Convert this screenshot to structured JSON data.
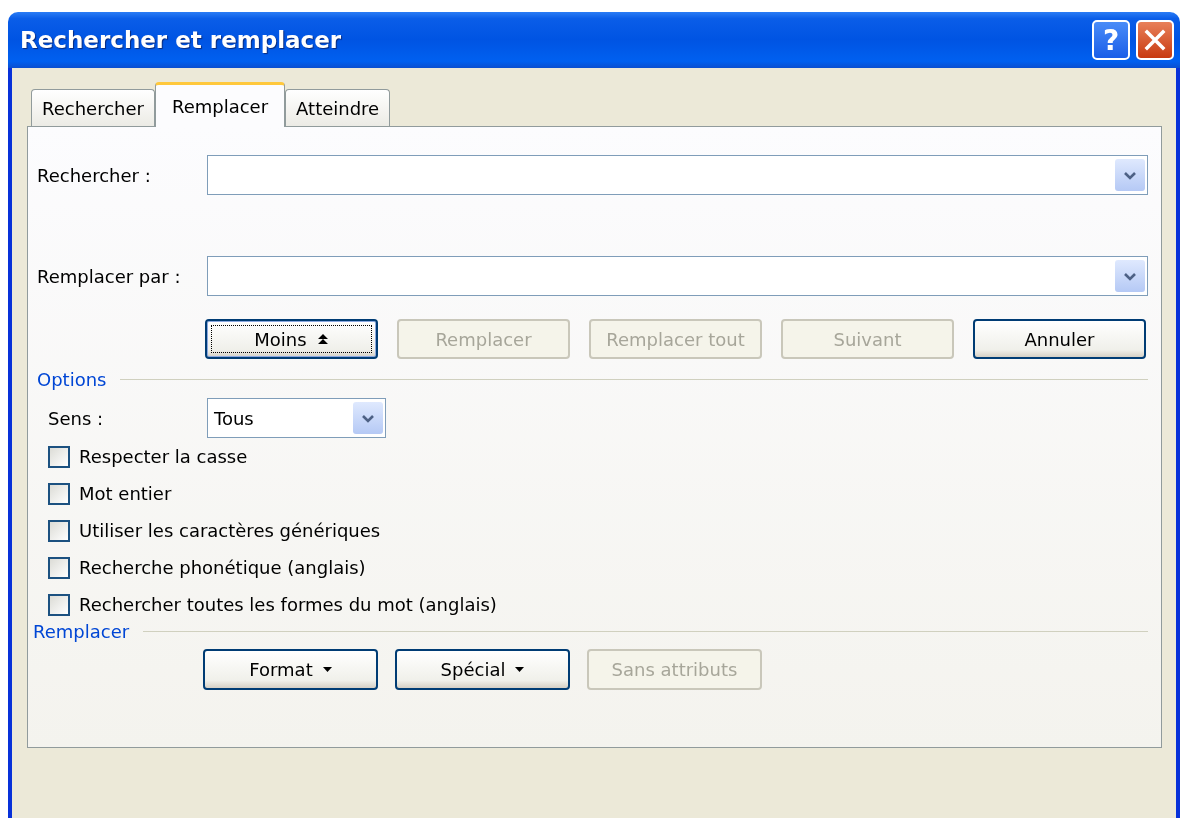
{
  "window": {
    "title": "Rechercher et remplacer",
    "help_button": "?"
  },
  "tabs": [
    {
      "label": "Rechercher",
      "selected": false
    },
    {
      "label": "Remplacer",
      "selected": true
    },
    {
      "label": "Atteindre",
      "selected": false
    }
  ],
  "fields": [
    {
      "label": "Rechercher :"
    },
    {
      "label": "Remplacer par :"
    }
  ],
  "actions": [
    {
      "label": "Moins",
      "kind": "toggle",
      "disabled": false,
      "focused": true
    },
    {
      "label": "Remplacer",
      "kind": "plain",
      "disabled": true,
      "focused": false
    },
    {
      "label": "Remplacer tout",
      "kind": "plain",
      "disabled": true,
      "focused": false
    },
    {
      "label": "Suivant",
      "kind": "plain",
      "disabled": true,
      "focused": false
    },
    {
      "label": "Annuler",
      "kind": "plain",
      "disabled": false,
      "focused": false
    }
  ],
  "options": {
    "title": "Options",
    "direction": {
      "label": "Sens :",
      "value": "Tous"
    },
    "checkboxes": [
      {
        "label": "Respecter la casse",
        "checked": false
      },
      {
        "label": "Mot entier",
        "checked": false
      },
      {
        "label": "Utiliser les caractères génériques",
        "checked": false
      },
      {
        "label": "Recherche phonétique (anglais)",
        "checked": false
      },
      {
        "label": "Rechercher toutes les formes du mot (anglais)",
        "checked": false
      }
    ]
  },
  "replace": {
    "title": "Remplacer",
    "buttons": [
      {
        "label": "Format",
        "kind": "menu",
        "disabled": false
      },
      {
        "label": "Spécial",
        "kind": "menu",
        "disabled": false
      },
      {
        "label": "Sans attributs",
        "kind": "plain",
        "disabled": true
      }
    ]
  }
}
